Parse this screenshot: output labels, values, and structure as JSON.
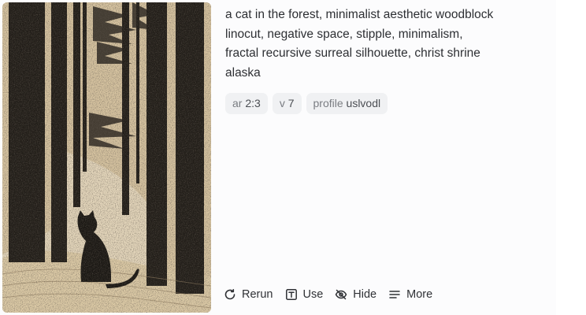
{
  "prompt": {
    "line1": "a cat in the forest, minimalist aesthetic woodblock",
    "line2": "linocut, negative space, stipple, minimalism,",
    "line3": "fractal recursive surreal silhouette, christ shrine",
    "line4": "alaska"
  },
  "params": [
    {
      "key": "ar",
      "value": "2:3"
    },
    {
      "key": "v",
      "value": "7"
    },
    {
      "key": "profile",
      "value": "uslvodl"
    }
  ],
  "actions": [
    {
      "label": "Rerun",
      "icon": "rerun-icon"
    },
    {
      "label": "Use",
      "icon": "text-box-icon"
    },
    {
      "label": "Hide",
      "icon": "eye-off-icon"
    },
    {
      "label": "More",
      "icon": "menu-lines-icon"
    }
  ],
  "colors": {
    "paper": "#d9c7a5",
    "ink": "#231f1a",
    "chip_bg": "#f0f1f3"
  }
}
